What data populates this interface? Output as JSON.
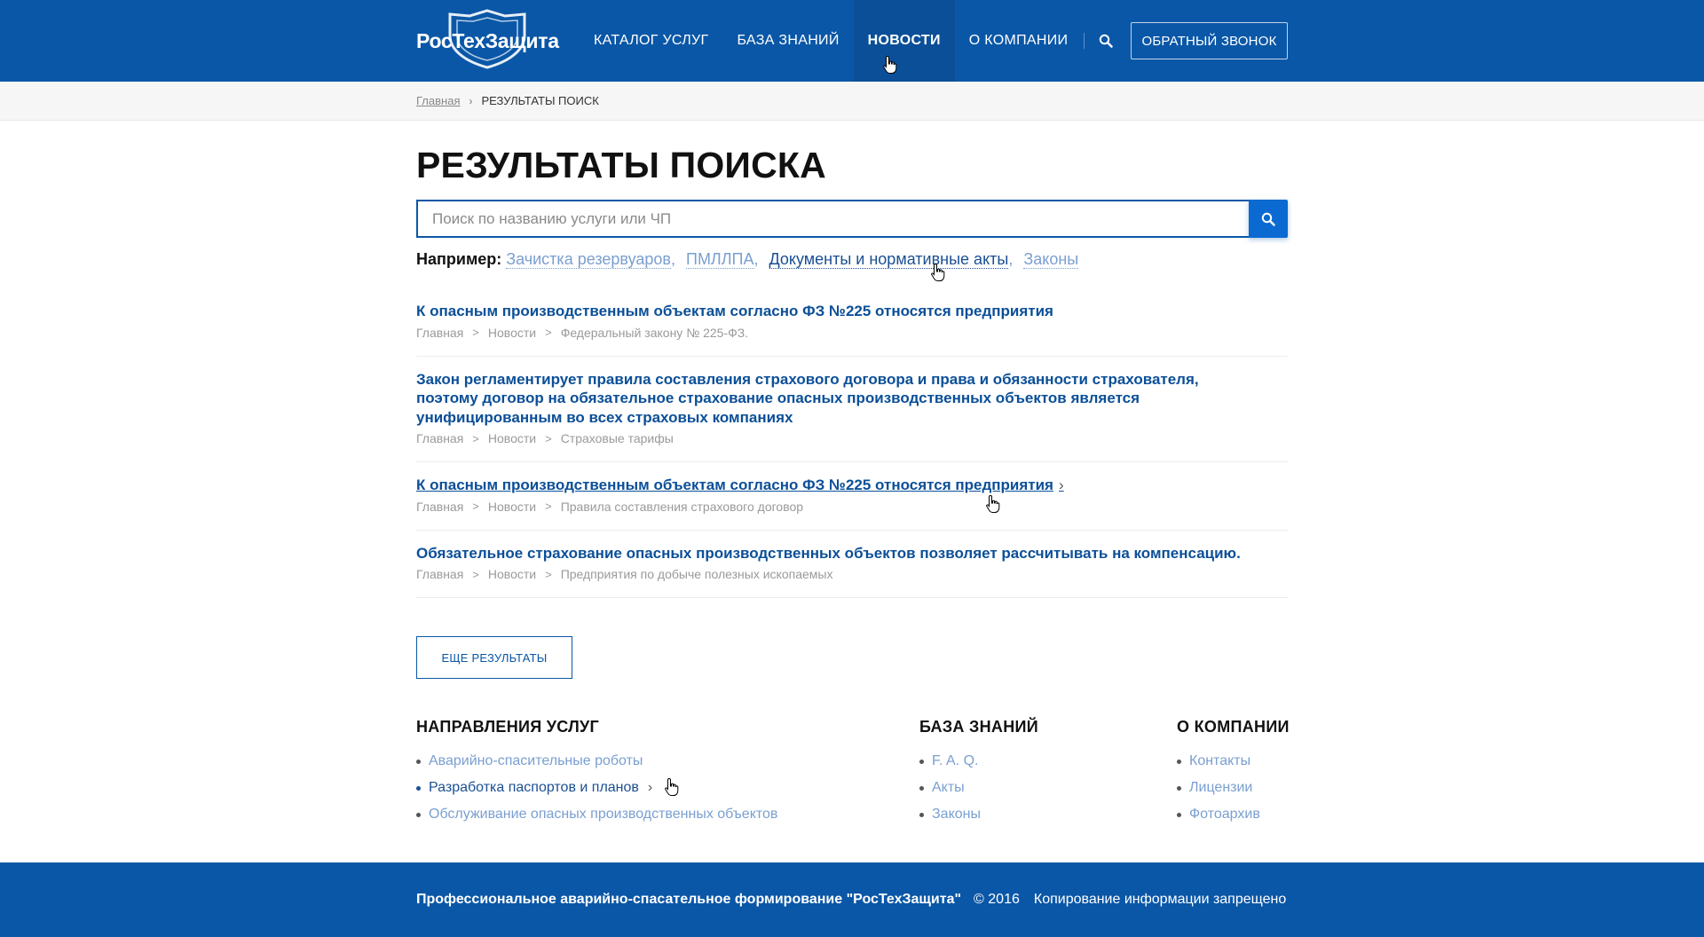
{
  "header": {
    "logo_text": "РосТехЗащита",
    "nav": [
      {
        "label": "КАТАЛОГ УСЛУГ"
      },
      {
        "label": "БАЗА ЗНАНИЙ"
      },
      {
        "label": "НОВОСТИ"
      },
      {
        "label": "О КОМПАНИИ"
      }
    ],
    "search_icon": "search-icon",
    "callback_label": "ОБРАТНЫЙ ЗВОНОК",
    "brand_color": "#0a57a7"
  },
  "breadcrumb": {
    "home": "Главная",
    "current": "РЕЗУЛЬТАТЫ ПОИСК"
  },
  "page": {
    "title": "РЕЗУЛЬТАТЫ ПОИСКА"
  },
  "search": {
    "placeholder": "Поиск по названию услуги или ЧП",
    "value": ""
  },
  "examples": {
    "label": "Например:",
    "items": [
      "Зачистка резервуаров",
      "ПМЛЛПА",
      "Документы и нормативные акты",
      "Законы"
    ]
  },
  "results": [
    {
      "title": "К опасным производственным объектам согласно ФЗ №225 относятся предприятия",
      "path": [
        "Главная",
        "Новости",
        "Федеральный закону № 225-ФЗ."
      ]
    },
    {
      "title": "Закон регламентирует правила составления страхового договора и права и обязанности страхователя, поэтому договор на обязательное страхование опасных производственных объектов является унифицированным во всех страховых компаниях",
      "path": [
        "Главная",
        "Новости",
        "Страховые тарифы"
      ]
    },
    {
      "title": "К опасным производственным объектам согласно ФЗ №225 относятся предприятия",
      "path": [
        "Главная",
        "Новости",
        "Правила составления страхового договор"
      ]
    },
    {
      "title": "Обязательное страхование опасных производственных объектов позволяет рассчитывать на компенсацию.",
      "path": [
        "Главная",
        "Новости",
        "Предприятия по добыче полезных ископаемых"
      ]
    }
  ],
  "more_label": "ЕЩЕ РЕЗУЛЬТАТЫ",
  "footer_links": {
    "services": {
      "title": "НАПРАВЛЕНИЯ УСЛУГ",
      "items": [
        "Аварийно-спасительные роботы",
        "Разработка паспортов и планов",
        "Обслуживание опасных производственных объектов"
      ]
    },
    "knowledge": {
      "title": "БАЗА ЗНАНИЙ",
      "items": [
        "F. A. Q.",
        "Акты",
        "Законы"
      ]
    },
    "company": {
      "title": "О КОМПАНИИ",
      "items": [
        "Контакты",
        "Лицензии",
        "Фотоархив"
      ]
    }
  },
  "footer": {
    "brand": "Профессиональное аварийно-спасательное формирование \"РосТехЗащита\"",
    "copyright": "© 2016",
    "notice": "Копирование информации запрещено"
  }
}
